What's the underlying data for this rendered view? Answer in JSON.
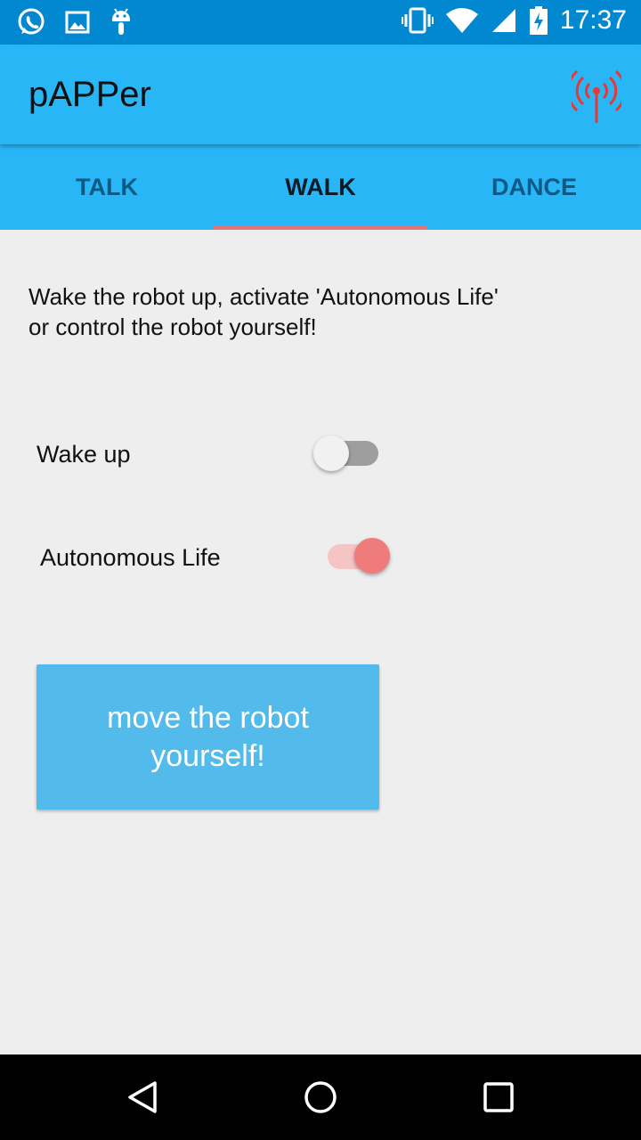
{
  "status_bar": {
    "time": "17:37",
    "left_icons": [
      "whatsapp-icon",
      "image-icon",
      "android-icon"
    ],
    "right_icons": [
      "vibrate-icon",
      "wifi-icon",
      "signal-icon",
      "battery-charging-icon"
    ]
  },
  "app_bar": {
    "title": "pAPPer",
    "action_icon": "antenna-icon",
    "action_color": "#e53935"
  },
  "tabs": [
    {
      "label": "TALK",
      "active": false
    },
    {
      "label": "WALK",
      "active": true
    },
    {
      "label": "DANCE",
      "active": false
    }
  ],
  "main": {
    "description_line1": "Wake the robot up, activate 'Autonomous Life'",
    "description_line2": "or control the robot yourself!",
    "wake_up": {
      "label": "Wake up",
      "checked": false
    },
    "autonomous_life": {
      "label": "Autonomous Life",
      "checked": true
    },
    "move_button_label": "move the robot yourself!"
  },
  "nav_bar": {
    "buttons": [
      "back-icon",
      "home-icon",
      "recents-icon"
    ]
  },
  "colors": {
    "status_bar": "#0288d1",
    "primary": "#29b6f6",
    "tab_indicator": "#e57373",
    "switch_on": "#ef7b7b",
    "button": "#53bbeb",
    "background": "#eeeeee"
  }
}
